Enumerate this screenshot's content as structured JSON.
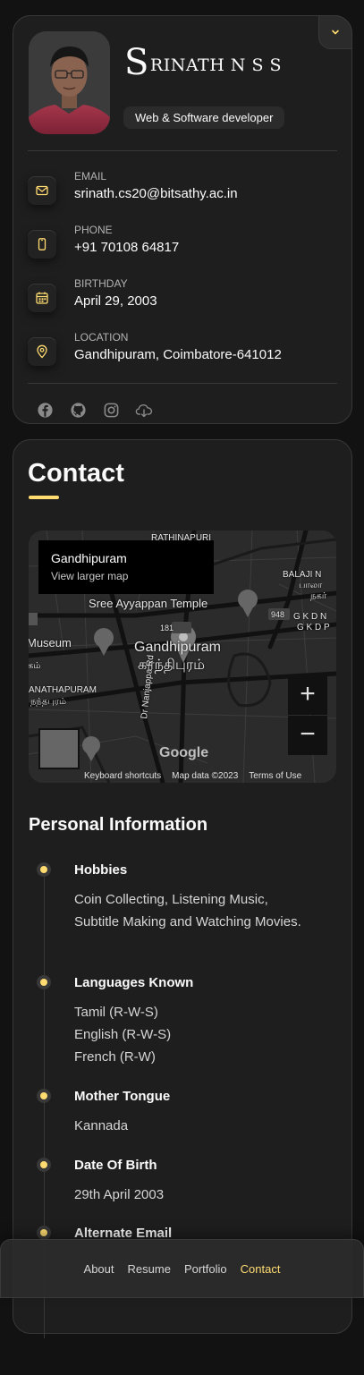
{
  "profile": {
    "name_first_letter": "S",
    "name_rest": "RINATH N S S",
    "title": "Web & Software developer"
  },
  "contacts": [
    {
      "label": "Email",
      "value": "srinath.cs20@bitsathy.ac.in",
      "icon": "mail-icon"
    },
    {
      "label": "Phone",
      "value": "+91 70108 64817",
      "icon": "phone-icon"
    },
    {
      "label": "Birthday",
      "value": "April 29, 2003",
      "icon": "calendar-icon"
    },
    {
      "label": "Location",
      "value": "Gandhipuram, Coimbatore-641012",
      "icon": "location-icon"
    }
  ],
  "social": [
    "facebook-icon",
    "github-icon",
    "instagram-icon",
    "cloud-download-icon"
  ],
  "article": {
    "heading": "Contact"
  },
  "map": {
    "place": "Gandhipuram",
    "larger_map": "View larger map",
    "labels": {
      "temple": "Sree Ayyappan Temple",
      "museum": "Museum",
      "center_en": "Gandhipuram",
      "center_ta": "காந்திபுரம்",
      "rathinapuri": "RATHINAPURI",
      "balaji": "BALAJI N",
      "balaji_ta": "பாலா",
      "nagar_ta": "நகர்",
      "gkdn": "G K D N",
      "gkdp": "G K D P",
      "anathapuram": "ANATHAPURAM",
      "anathapuram_ta": "நந்தபுரம்",
      "road": "Dr Nanjappa Rd",
      "route_181": "181",
      "route_948": "948",
      "ta_small": "கம்"
    },
    "footer": [
      "Keyboard shortcuts",
      "Map data ©2023",
      "Terms of Use"
    ],
    "google": "Google",
    "zoom_in": "+",
    "zoom_out": "−"
  },
  "personal": {
    "heading": "Personal Information",
    "items": [
      {
        "title": "Hobbies",
        "body": "Coin Collecting, Listening Music, Subtitle Making and Watching Movies."
      },
      {
        "title": "Languages Known",
        "lines": [
          "Tamil (R-W-S)",
          "English (R-W-S)",
          "French (R-W)"
        ]
      },
      {
        "title": "Mother Tongue",
        "body": "Kannada"
      },
      {
        "title": "Date Of Birth",
        "body": "29th April 2003"
      },
      {
        "title": "Alternate Email",
        "body": ""
      }
    ]
  },
  "nav": {
    "items": [
      "About",
      "Resume",
      "Portfolio",
      "Contact"
    ],
    "active": "Contact"
  },
  "colors": {
    "accent": "#ffdb70",
    "background": "#121212",
    "card": "#1e1e1f"
  }
}
